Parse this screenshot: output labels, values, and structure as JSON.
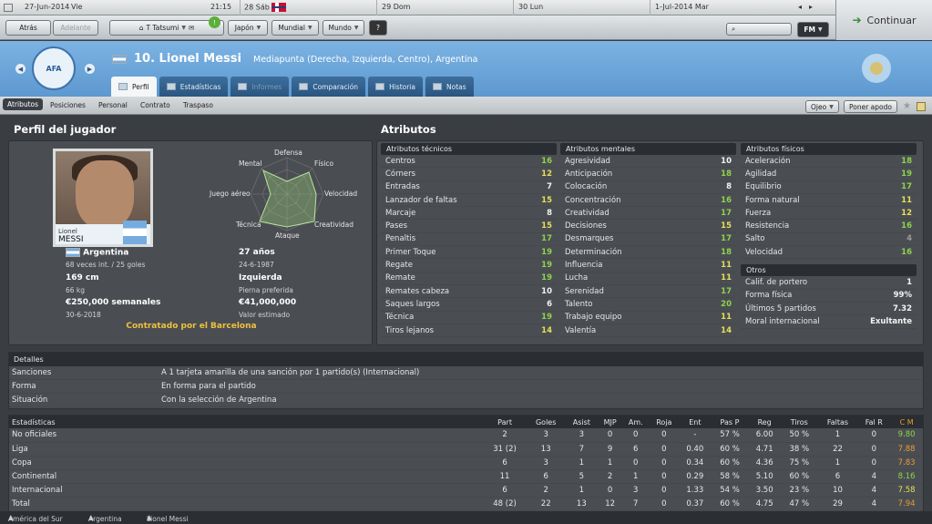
{
  "topbar": {
    "date": "27-Jun-2014",
    "day": "Vie",
    "time": "21:15",
    "cal": [
      {
        "n": "28",
        "d": "Sáb"
      },
      {
        "n": "29",
        "d": "Dom"
      },
      {
        "n": "30",
        "d": "Lun"
      },
      {
        "n": "1-Jul-2014",
        "d": "Mar"
      }
    ]
  },
  "nav": {
    "back": "Atrás",
    "forward": "Adelante",
    "manager": "T Tatsumi",
    "country": "Japón",
    "world": "Mundial",
    "mundo": "Mundo",
    "help": "?",
    "continue": "Continuar",
    "fm": "FM"
  },
  "player": {
    "number_name": "10. Lionel Messi",
    "role": "Mediapunta (Derecha, Izquierda, Centro), Argentina",
    "crest": "AFA"
  },
  "tabs": [
    "Perfil",
    "Estadísticas",
    "Informes",
    "Comparación",
    "Historia",
    "Notas"
  ],
  "subtabs": [
    "Atributos",
    "Posiciones",
    "Personal",
    "Contrato",
    "Traspaso"
  ],
  "subbuttons": {
    "scout": "Ojeo",
    "focus": "Poner apodo"
  },
  "profile": {
    "title": "Perfil del jugador",
    "photo_label1": "Lionel",
    "photo_label2": "MESSI",
    "radar": [
      "Defensa",
      "Físico",
      "Velocidad",
      "Creatividad",
      "Ataque",
      "Técnica",
      "Juego aéreo",
      "Mental"
    ],
    "nationality": "Argentina",
    "caps": "68 veces int. / 25 goles",
    "age": "27 años",
    "dob": "24-6-1987",
    "height": "169 cm",
    "weight": "66 kg",
    "foot": "Izquierda",
    "foot_label": "Pierna preferida",
    "wage": "€250,000 semanales",
    "contract_end": "30-6-2018",
    "value": "€41,000,000",
    "value_label": "Valor estimado",
    "contract": "Contratado por el Barcelona"
  },
  "attributes": {
    "title": "Atributos",
    "tech_title": "Atributos técnicos",
    "technical": [
      [
        "Centros",
        "16"
      ],
      [
        "Córners",
        "12"
      ],
      [
        "Entradas",
        "7"
      ],
      [
        "Lanzador de faltas",
        "15"
      ],
      [
        "Marcaje",
        "8"
      ],
      [
        "Pases",
        "15"
      ],
      [
        "Penaltis",
        "17"
      ],
      [
        "Primer Toque",
        "19"
      ],
      [
        "Regate",
        "19"
      ],
      [
        "Remate",
        "19"
      ],
      [
        "Remates cabeza",
        "10"
      ],
      [
        "Saques largos",
        "6"
      ],
      [
        "Técnica",
        "19"
      ],
      [
        "Tiros lejanos",
        "14"
      ]
    ],
    "mental_title": "Atributos mentales",
    "mental": [
      [
        "Agresividad",
        "10"
      ],
      [
        "Anticipación",
        "18"
      ],
      [
        "Colocación",
        "8"
      ],
      [
        "Concentración",
        "16"
      ],
      [
        "Creatividad",
        "17"
      ],
      [
        "Decisiones",
        "15"
      ],
      [
        "Desmarques",
        "17"
      ],
      [
        "Determinación",
        "18"
      ],
      [
        "Influencia",
        "11"
      ],
      [
        "Lucha",
        "11"
      ],
      [
        "Serenidad",
        "17"
      ],
      [
        "Talento",
        "20"
      ],
      [
        "Trabajo equipo",
        "11"
      ],
      [
        "Valentía",
        "14"
      ]
    ],
    "phys_title": "Atributos físicos",
    "physical": [
      [
        "Aceleración",
        "18"
      ],
      [
        "Agilidad",
        "19"
      ],
      [
        "Equilibrio",
        "17"
      ],
      [
        "Forma natural",
        "11"
      ],
      [
        "Fuerza",
        "12"
      ],
      [
        "Resistencia",
        "16"
      ],
      [
        "Salto",
        "4"
      ],
      [
        "Velocidad",
        "16"
      ]
    ],
    "other_title": "Otros",
    "other": [
      [
        "Calif. de portero",
        "1"
      ],
      [
        "Forma física",
        "99%"
      ],
      [
        "Últimos 5 partidos",
        "7.32"
      ],
      [
        "Moral internacional",
        "Exultante"
      ]
    ]
  },
  "details": {
    "title": "Detalles",
    "rows": [
      [
        "Sanciones",
        "A 1 tarjeta amarilla de una sanción por 1 partido(s) (Internacional)"
      ],
      [
        "Forma",
        "En forma para el partido"
      ],
      [
        "Situación",
        "Con la selección de Argentina"
      ]
    ]
  },
  "stats": {
    "headers": [
      "Estadísticas",
      "Part",
      "Goles",
      "Asist",
      "MJP",
      "Am.",
      "Roja",
      "Ent",
      "Pas P",
      "Reg",
      "Tiros",
      "Faltas",
      "Fal R",
      "C M"
    ],
    "rows": [
      [
        "No oficiales",
        "2",
        "3",
        "3",
        "0",
        "0",
        "0",
        "-",
        "57 %",
        "6.00",
        "50 %",
        "1",
        "0",
        "9.80"
      ],
      [
        "Liga",
        "31 (2)",
        "13",
        "7",
        "9",
        "6",
        "0",
        "0.40",
        "60 %",
        "4.71",
        "38 %",
        "22",
        "0",
        "7.88"
      ],
      [
        "Copa",
        "6",
        "3",
        "1",
        "1",
        "0",
        "0",
        "0.34",
        "60 %",
        "4.36",
        "75 %",
        "1",
        "0",
        "7.83"
      ],
      [
        "Continental",
        "11",
        "6",
        "5",
        "2",
        "1",
        "0",
        "0.29",
        "58 %",
        "5.10",
        "60 %",
        "6",
        "4",
        "8.16"
      ],
      [
        "Internacional",
        "6",
        "2",
        "1",
        "0",
        "3",
        "0",
        "1.33",
        "54 %",
        "3.50",
        "23 %",
        "10",
        "4",
        "7.58"
      ],
      [
        "Total",
        "48 (2)",
        "22",
        "13",
        "12",
        "7",
        "0",
        "0.37",
        "60 %",
        "4.75",
        "47 %",
        "29",
        "4",
        "7.94"
      ]
    ]
  },
  "footer": [
    "América del Sur",
    "Argentina",
    "Lionel Messi"
  ]
}
